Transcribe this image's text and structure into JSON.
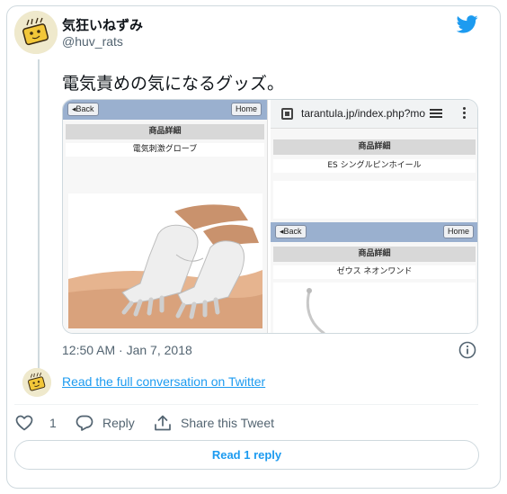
{
  "tweet": {
    "display_name": "気狂いねずみ",
    "handle": "@huv_rats",
    "text": "電気責めの気になるグッズ。",
    "timestamp": "12:50 AM · Jan 7, 2018",
    "read_conversation_link": "Read the full conversation on Twitter",
    "like_count": "1",
    "reply_label": "Reply",
    "share_label": "Share this Tweet",
    "read_replies_button": "Read 1 reply"
  },
  "media": {
    "left_panel": {
      "back_label": "Back",
      "home_label": "Home",
      "section_title": "商品詳細",
      "item_name": "電気刺激グローブ"
    },
    "right_panel": {
      "url": "tarantula.jp/index.php?mo",
      "section1_title": "商品詳細",
      "item1_name": "ES シングルピンホイール",
      "back_label": "Back",
      "home_label": "Home",
      "section2_title": "商品詳細",
      "item2_name": "ゼウス ネオンワンド"
    }
  },
  "colors": {
    "link_blue": "#1d9bf0",
    "border": "#cfd9de",
    "secondary_text": "#536471",
    "phone_bar": "#9ab0cf"
  },
  "icons": [
    "twitter-bird-icon",
    "info-icon",
    "heart-icon",
    "reply-icon",
    "share-icon",
    "lock-icon",
    "tabs-icon",
    "kebab-menu-icon"
  ]
}
